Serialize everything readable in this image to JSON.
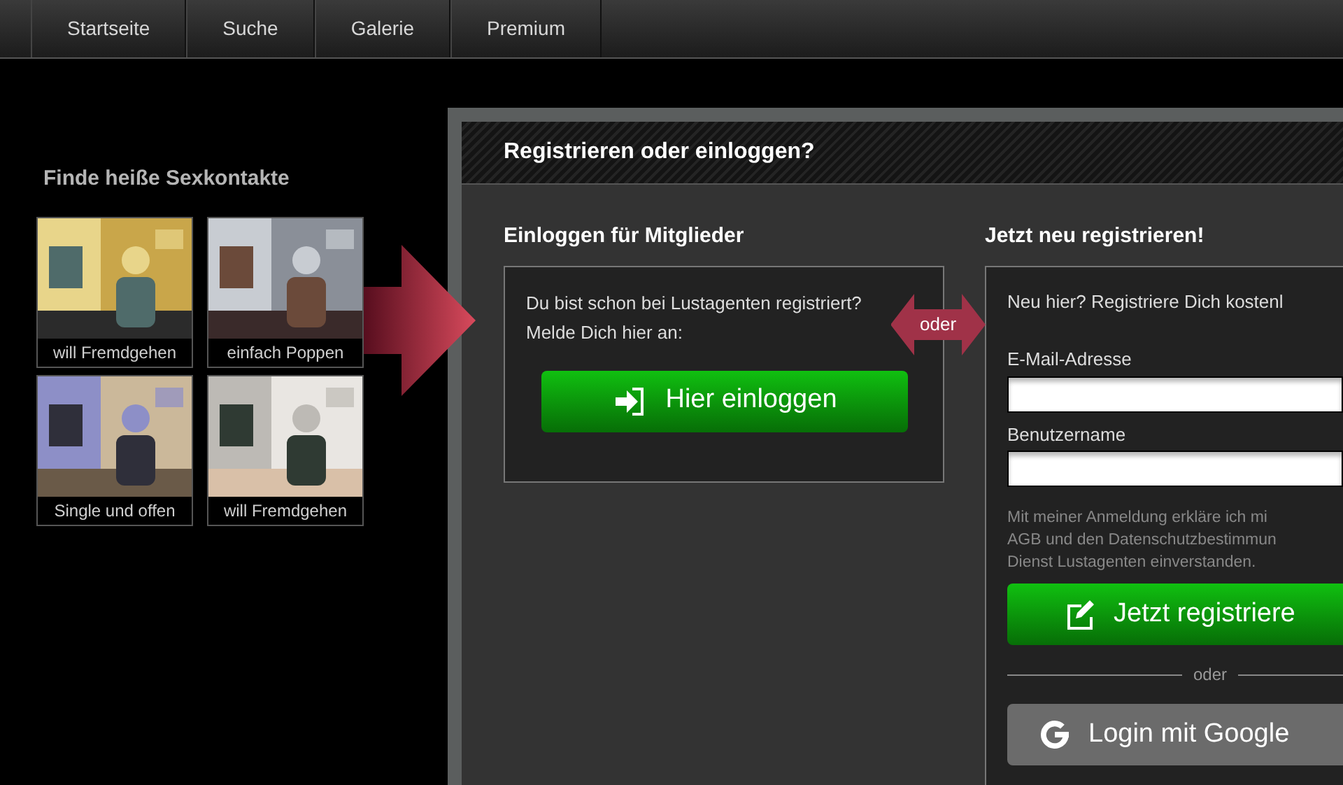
{
  "nav": {
    "items": [
      {
        "label": "Startseite"
      },
      {
        "label": "Suche"
      },
      {
        "label": "Galerie"
      },
      {
        "label": "Premium"
      }
    ]
  },
  "contacts": {
    "title": "Finde heiße Sexkontakte",
    "items": [
      {
        "caption": "will Fremdgehen",
        "kind": "picture"
      },
      {
        "caption": "einfach Poppen",
        "kind": "picture"
      },
      {
        "caption": "Single und offen",
        "kind": "picture"
      },
      {
        "caption": "will Fremdgehen",
        "kind": "picture"
      }
    ]
  },
  "dialog": {
    "title": "Registrieren oder einloggen?",
    "login": {
      "heading": "Einloggen für Mitglieder",
      "text_lines": [
        "Du bist schon bei Lustagenten registriert?",
        "Melde Dich hier an:"
      ],
      "button": "Hier einloggen"
    },
    "separator": "oder",
    "register": {
      "heading": "Jetzt neu registrieren!",
      "intro": "Neu hier? Registriere Dich kostenl",
      "fields": [
        {
          "label": "E-Mail-Adresse"
        },
        {
          "label": "Benutzername"
        }
      ],
      "legal_lines": [
        "Mit meiner Anmeldung erkläre ich mi",
        "AGB und den Datenschutzbestimmun",
        "Dienst Lustagenten einverstanden."
      ],
      "button": "Jetzt registriere",
      "divider": "oder",
      "google_button": "Login mit Google"
    }
  }
}
